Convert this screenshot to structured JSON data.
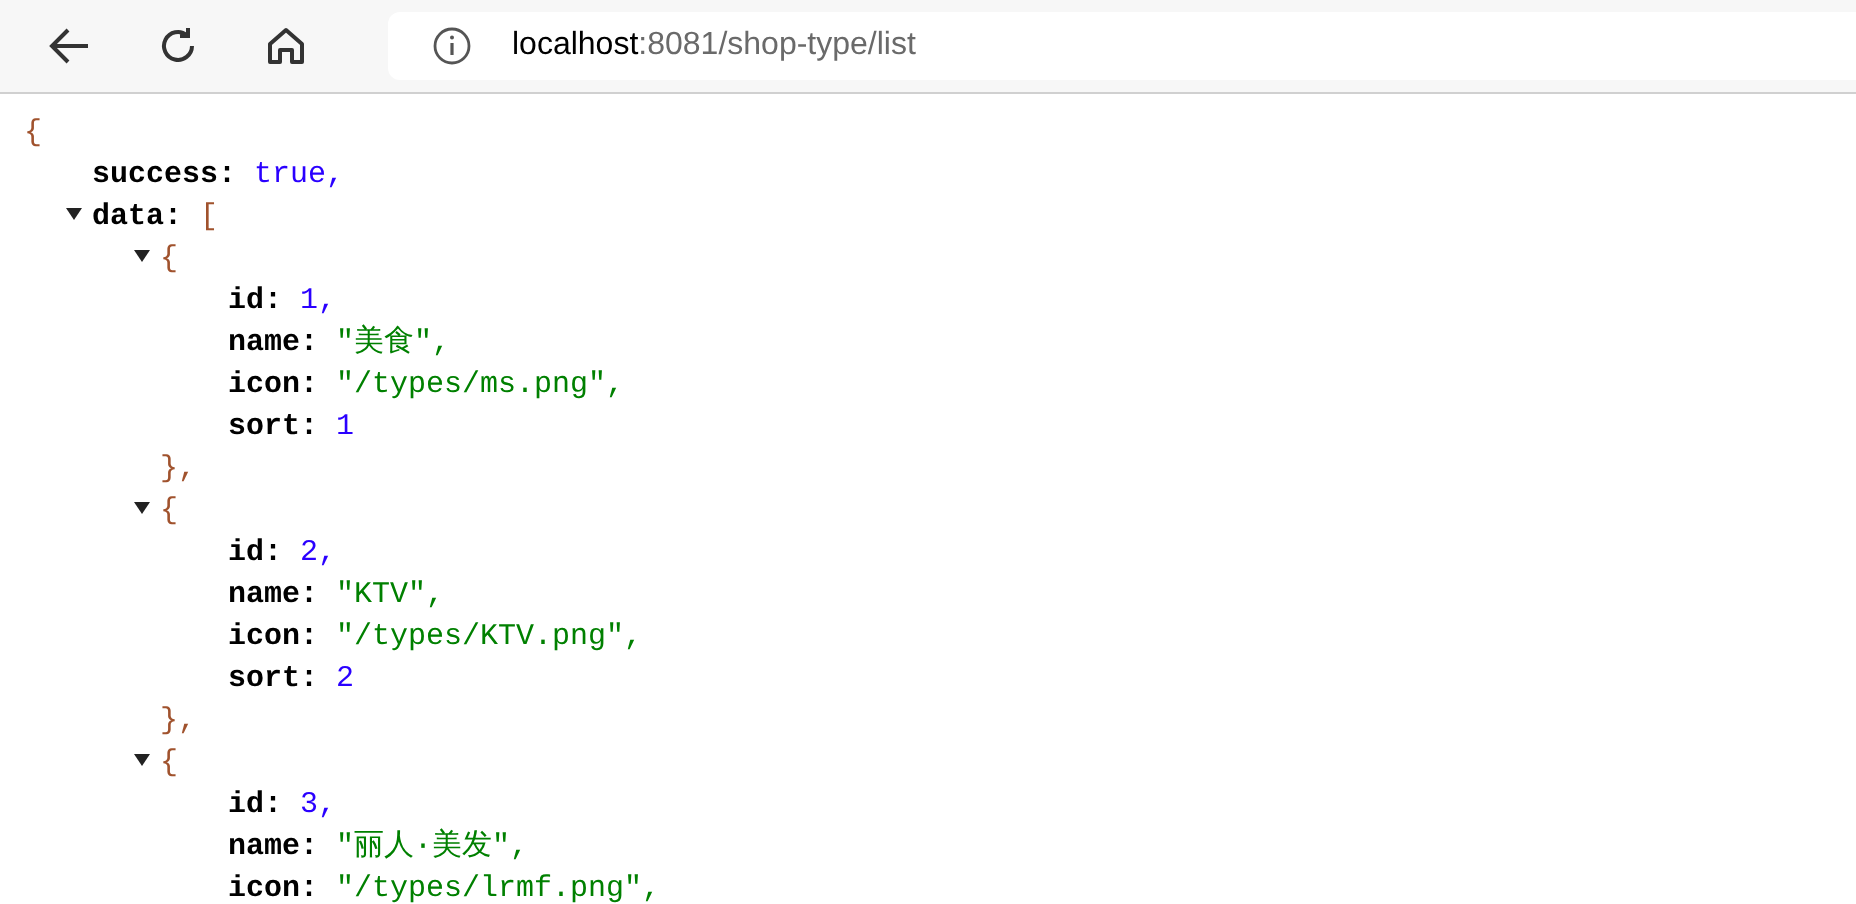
{
  "address_bar": {
    "host": "localhost",
    "path": ":8081/shop-type/list"
  },
  "json_view": {
    "open": "{",
    "children": [
      {
        "key": "success:",
        "value": "true,",
        "kind": "boolean"
      },
      {
        "key": "data:",
        "open": "[",
        "expanded": true,
        "children": [
          {
            "open": "{",
            "expanded": true,
            "close": "},",
            "children": [
              {
                "key": "id:",
                "value": "1,",
                "kind": "number"
              },
              {
                "key": "name:",
                "value": "\"美食\",",
                "kind": "string"
              },
              {
                "key": "icon:",
                "value": "\"/types/ms.png\",",
                "kind": "string"
              },
              {
                "key": "sort:",
                "value": "1",
                "kind": "number"
              }
            ]
          },
          {
            "open": "{",
            "expanded": true,
            "close": "},",
            "children": [
              {
                "key": "id:",
                "value": "2,",
                "kind": "number"
              },
              {
                "key": "name:",
                "value": "\"KTV\",",
                "kind": "string"
              },
              {
                "key": "icon:",
                "value": "\"/types/KTV.png\",",
                "kind": "string"
              },
              {
                "key": "sort:",
                "value": "2",
                "kind": "number"
              }
            ]
          },
          {
            "open": "{",
            "expanded": true,
            "children": [
              {
                "key": "id:",
                "value": "3,",
                "kind": "number"
              },
              {
                "key": "name:",
                "value": "\"丽人·美发\",",
                "kind": "string"
              },
              {
                "key": "icon:",
                "value": "\"/types/lrmf.png\",",
                "kind": "string"
              }
            ]
          }
        ]
      }
    ]
  }
}
